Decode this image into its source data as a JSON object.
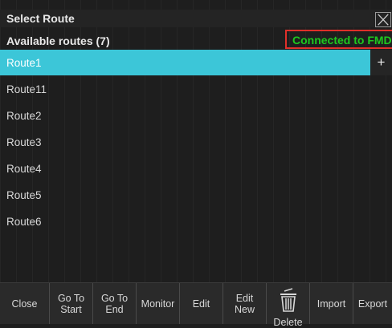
{
  "dialog": {
    "title": "Select Route",
    "routes_heading": "Available routes (7)",
    "connection_status": "Connected to FMD"
  },
  "routes": [
    "Route1",
    "Route11",
    "Route2",
    "Route3",
    "Route4",
    "Route5",
    "Route6"
  ],
  "add_label": "+",
  "toolbar": {
    "close": "Close",
    "go_to_start": "Go To Start",
    "go_to_end": "Go To End",
    "monitor": "Monitor",
    "edit": "Edit",
    "edit_new": "Edit New",
    "delete": "Delete",
    "import": "Import",
    "export": "Export"
  },
  "colors": {
    "selection": "#3cc6d8",
    "status_text": "#1ec81e",
    "status_border": "#e0302a"
  }
}
